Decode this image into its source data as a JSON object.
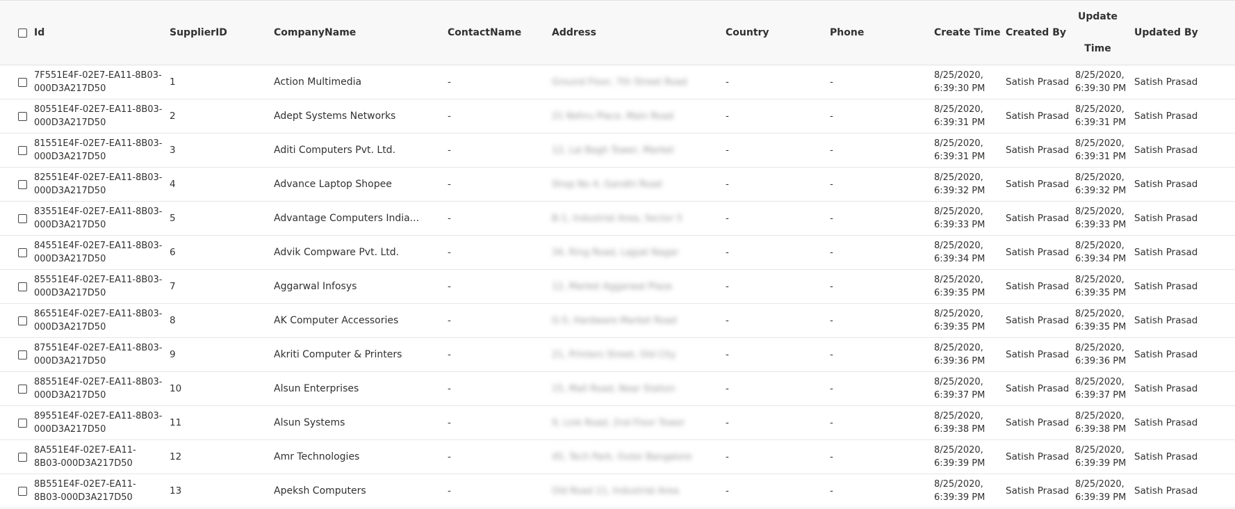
{
  "columns": {
    "id": "Id",
    "supplier_id": "SupplierID",
    "company_name": "CompanyName",
    "contact_name": "ContactName",
    "address": "Address",
    "country": "Country",
    "phone": "Phone",
    "create_time": "Create Time",
    "created_by": "Created By",
    "update_time_line1": "Update",
    "update_time_line2": "Time",
    "updated_by": "Updated By"
  },
  "rows": [
    {
      "id": "7F551E4F-02E7-EA11-8B03-000D3A217D50",
      "supplier_id": "1",
      "company": "Action Multimedia",
      "contact": "-",
      "address": "Ground Floor, 7th Street Road",
      "country": "-",
      "phone": "-",
      "create_time": "8/25/2020, 6:39:30 PM",
      "created_by": "Satish Prasad",
      "update_time": "8/25/2020, 6:39:30 PM",
      "updated_by": "Satish Prasad"
    },
    {
      "id": "80551E4F-02E7-EA11-8B03-000D3A217D50",
      "supplier_id": "2",
      "company": "Adept Systems Networks",
      "contact": "-",
      "address": "21 Nehru Place, Main Road",
      "country": "-",
      "phone": "-",
      "create_time": "8/25/2020, 6:39:31 PM",
      "created_by": "Satish Prasad",
      "update_time": "8/25/2020, 6:39:31 PM",
      "updated_by": "Satish Prasad"
    },
    {
      "id": "81551E4F-02E7-EA11-8B03-000D3A217D50",
      "supplier_id": "3",
      "company": "Aditi Computers Pvt. Ltd.",
      "contact": "-",
      "address": "12, Lal Bagh Tower, Market",
      "country": "-",
      "phone": "-",
      "create_time": "8/25/2020, 6:39:31 PM",
      "created_by": "Satish Prasad",
      "update_time": "8/25/2020, 6:39:31 PM",
      "updated_by": "Satish Prasad"
    },
    {
      "id": "82551E4F-02E7-EA11-8B03-000D3A217D50",
      "supplier_id": "4",
      "company": "Advance Laptop Shopee",
      "contact": "-",
      "address": "Shop No 4, Gandhi Road",
      "country": "-",
      "phone": "-",
      "create_time": "8/25/2020, 6:39:32 PM",
      "created_by": "Satish Prasad",
      "update_time": "8/25/2020, 6:39:32 PM",
      "updated_by": "Satish Prasad"
    },
    {
      "id": "83551E4F-02E7-EA11-8B03-000D3A217D50",
      "supplier_id": "5",
      "company": "Advantage Computers India...",
      "contact": "-",
      "address": "B-1, Industrial Area, Sector 5",
      "country": "-",
      "phone": "-",
      "create_time": "8/25/2020, 6:39:33 PM",
      "created_by": "Satish Prasad",
      "update_time": "8/25/2020, 6:39:33 PM",
      "updated_by": "Satish Prasad"
    },
    {
      "id": "84551E4F-02E7-EA11-8B03-000D3A217D50",
      "supplier_id": "6",
      "company": "Advik Compware Pvt. Ltd.",
      "contact": "-",
      "address": "34, Ring Road, Lajpat Nagar",
      "country": "-",
      "phone": "-",
      "create_time": "8/25/2020, 6:39:34 PM",
      "created_by": "Satish Prasad",
      "update_time": "8/25/2020, 6:39:34 PM",
      "updated_by": "Satish Prasad"
    },
    {
      "id": "85551E4F-02E7-EA11-8B03-000D3A217D50",
      "supplier_id": "7",
      "company": "Aggarwal Infosys",
      "contact": "-",
      "address": "12, Market Aggarwal Plaza",
      "country": "-",
      "phone": "-",
      "create_time": "8/25/2020, 6:39:35 PM",
      "created_by": "Satish Prasad",
      "update_time": "8/25/2020, 6:39:35 PM",
      "updated_by": "Satish Prasad"
    },
    {
      "id": "86551E4F-02E7-EA11-8B03-000D3A217D50",
      "supplier_id": "8",
      "company": "AK Computer Accessories",
      "contact": "-",
      "address": "G-5, Hardware Market Road",
      "country": "-",
      "phone": "-",
      "create_time": "8/25/2020, 6:39:35 PM",
      "created_by": "Satish Prasad",
      "update_time": "8/25/2020, 6:39:35 PM",
      "updated_by": "Satish Prasad"
    },
    {
      "id": "87551E4F-02E7-EA11-8B03-000D3A217D50",
      "supplier_id": "9",
      "company": "Akriti Computer & Printers",
      "contact": "-",
      "address": "21, Printers Street, Old City",
      "country": "-",
      "phone": "-",
      "create_time": "8/25/2020, 6:39:36 PM",
      "created_by": "Satish Prasad",
      "update_time": "8/25/2020, 6:39:36 PM",
      "updated_by": "Satish Prasad"
    },
    {
      "id": "88551E4F-02E7-EA11-8B03-000D3A217D50",
      "supplier_id": "10",
      "company": "Alsun Enterprises",
      "contact": "-",
      "address": "15, Mall Road, Near Station",
      "country": "-",
      "phone": "-",
      "create_time": "8/25/2020, 6:39:37 PM",
      "created_by": "Satish Prasad",
      "update_time": "8/25/2020, 6:39:37 PM",
      "updated_by": "Satish Prasad"
    },
    {
      "id": "89551E4F-02E7-EA11-8B03-000D3A217D50",
      "supplier_id": "11",
      "company": "Alsun Systems",
      "contact": "-",
      "address": "9, Link Road, 2nd Floor Tower",
      "country": "-",
      "phone": "-",
      "create_time": "8/25/2020, 6:39:38 PM",
      "created_by": "Satish Prasad",
      "update_time": "8/25/2020, 6:39:38 PM",
      "updated_by": "Satish Prasad"
    },
    {
      "id": "8A551E4F-02E7-EA11-8B03-000D3A217D50",
      "supplier_id": "12",
      "company": "Amr Technologies",
      "contact": "-",
      "address": "45, Tech Park, Outer Bangalore",
      "country": "-",
      "phone": "-",
      "create_time": "8/25/2020, 6:39:39 PM",
      "created_by": "Satish Prasad",
      "update_time": "8/25/2020, 6:39:39 PM",
      "updated_by": "Satish Prasad"
    },
    {
      "id": "8B551E4F-02E7-EA11-8B03-000D3A217D50",
      "supplier_id": "13",
      "company": "Apeksh Computers",
      "contact": "-",
      "address": "Old Road 11, Industrial Area",
      "country": "-",
      "phone": "-",
      "create_time": "8/25/2020, 6:39:39 PM",
      "created_by": "Satish Prasad",
      "update_time": "8/25/2020, 6:39:39 PM",
      "updated_by": "Satish Prasad"
    }
  ]
}
